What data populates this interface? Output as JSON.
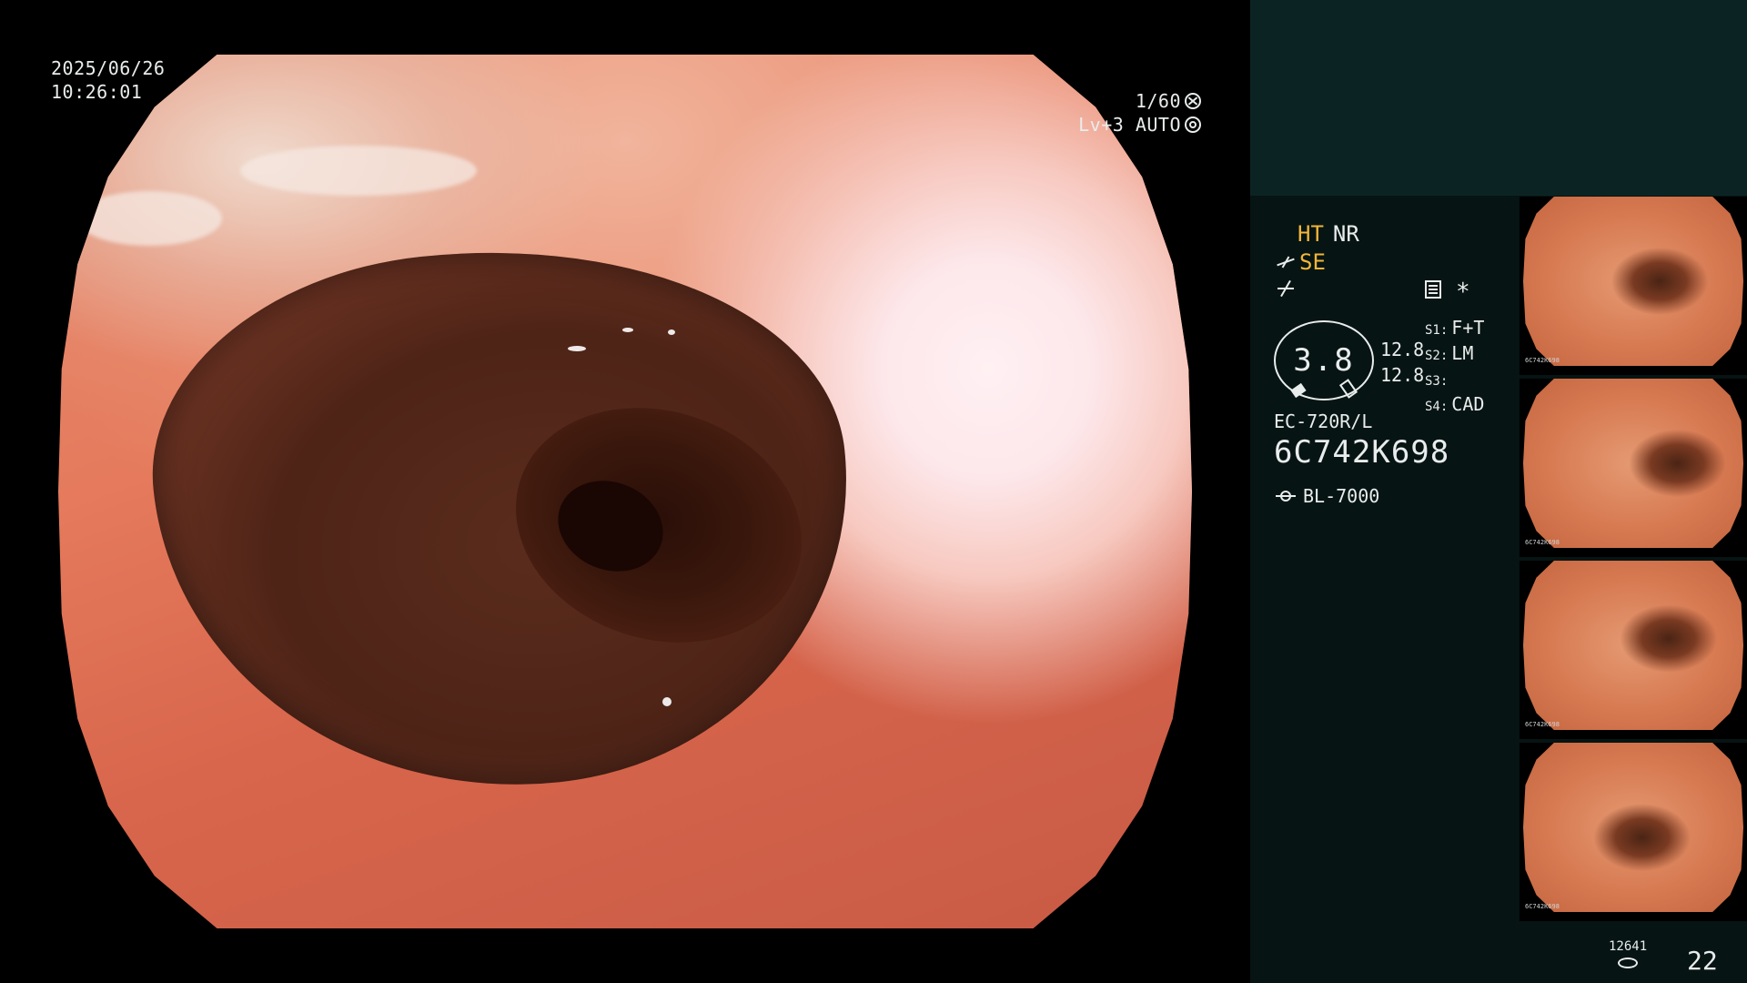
{
  "overlay": {
    "date": "2025/06/26",
    "time": "10:26:01",
    "shutter": "1/60",
    "brightness": "Lv+3 AUTO"
  },
  "panel": {
    "ht": "HT",
    "nr": "NR",
    "se": "SE",
    "star": "*",
    "gauge_value": "3.8",
    "gauge_side_top": "12.8",
    "gauge_side_bottom": "12.8",
    "s_list": [
      {
        "key": "S1:",
        "value": "F+T"
      },
      {
        "key": "S2:",
        "value": "LM"
      },
      {
        "key": "S3:",
        "value": ""
      },
      {
        "key": "S4:",
        "value": "CAD"
      }
    ],
    "scope_model": "EC-720R/L",
    "serial": "6C742K698",
    "light_source": "BL-7000",
    "image_count_small": "12641",
    "image_count_big": "22"
  },
  "thumbnails": [
    {
      "label_id": "6C742K698"
    },
    {
      "label_id": "6C742K698"
    },
    {
      "label_id": "6C742K698"
    },
    {
      "label_id": "6C742K698"
    }
  ],
  "colors": {
    "accent_orange": "#f2b53a",
    "panel_bg": "#061413",
    "panel_top_bg": "#0b2423",
    "text": "#e9ecec"
  },
  "icons": [
    "aperture-icon",
    "iris-icon",
    "pen-icon",
    "enhancement-icon",
    "report-icon",
    "light-source-icon",
    "storage-disk-icon"
  ]
}
